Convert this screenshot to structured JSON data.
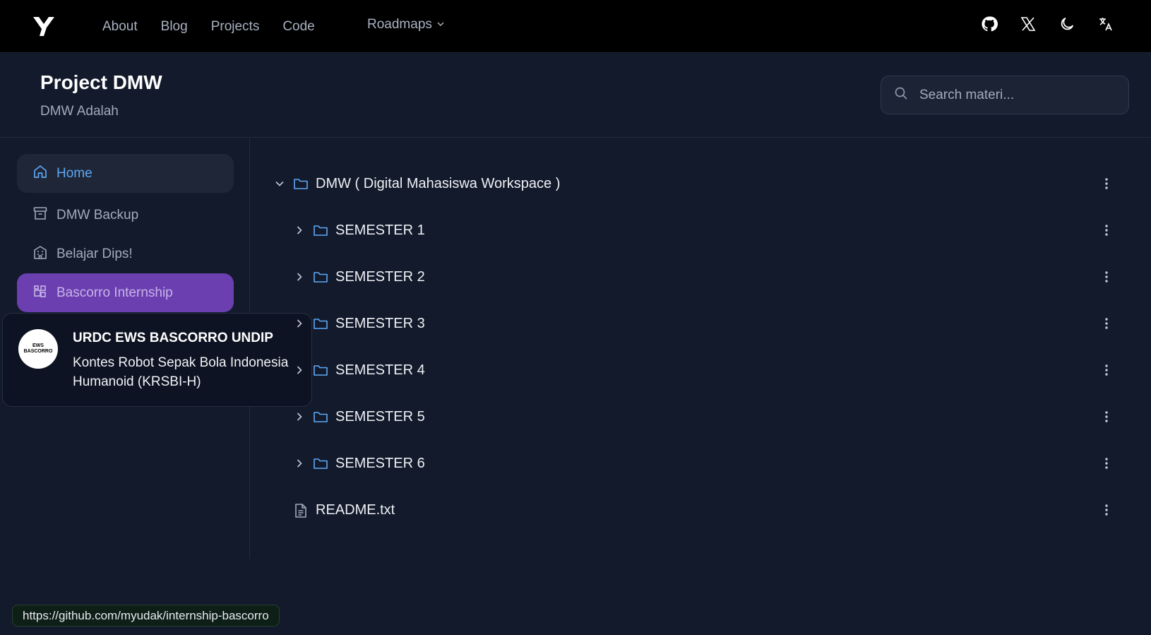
{
  "nav": {
    "links": [
      "About",
      "Blog",
      "Projects",
      "Code"
    ],
    "roadmaps_label": "Roadmaps",
    "icons": [
      "github-icon",
      "x-icon",
      "moon-icon",
      "translate-icon"
    ]
  },
  "header": {
    "title": "Project DMW",
    "subtitle": "DMW Adalah",
    "search_placeholder": "Search materi..."
  },
  "sidebar": {
    "items": [
      {
        "label": "Home",
        "icon": "home-icon",
        "state": "active"
      },
      {
        "label": "DMW Backup",
        "icon": "archive-icon",
        "state": "normal"
      },
      {
        "label": "Belajar Dips!",
        "icon": "building-icon",
        "state": "normal"
      },
      {
        "label": "Bascorro Internship",
        "icon": "widgets-icon",
        "state": "hover"
      }
    ]
  },
  "popover": {
    "logo_text": "EWS BASCORRO",
    "title": "URDC EWS BASCORRO UNDIP",
    "description": "Kontes Robot Sepak Bola Indonesia Humanoid (KRSBI-H)"
  },
  "tree": {
    "root": {
      "label": "DMW ( Digital Mahasiswa Workspace )",
      "expanded": true
    },
    "folders": [
      "SEMESTER 1",
      "SEMESTER 2",
      "SEMESTER 3",
      "SEMESTER 4",
      "SEMESTER 5",
      "SEMESTER 6"
    ],
    "file": "README.txt"
  },
  "status_url": "https://github.com/myudak/internship-bascorro",
  "colors": {
    "accent": "#5fa8f5",
    "hover_purple": "#6b3fb0",
    "background": "#121a2b",
    "topbar": "#000000"
  }
}
